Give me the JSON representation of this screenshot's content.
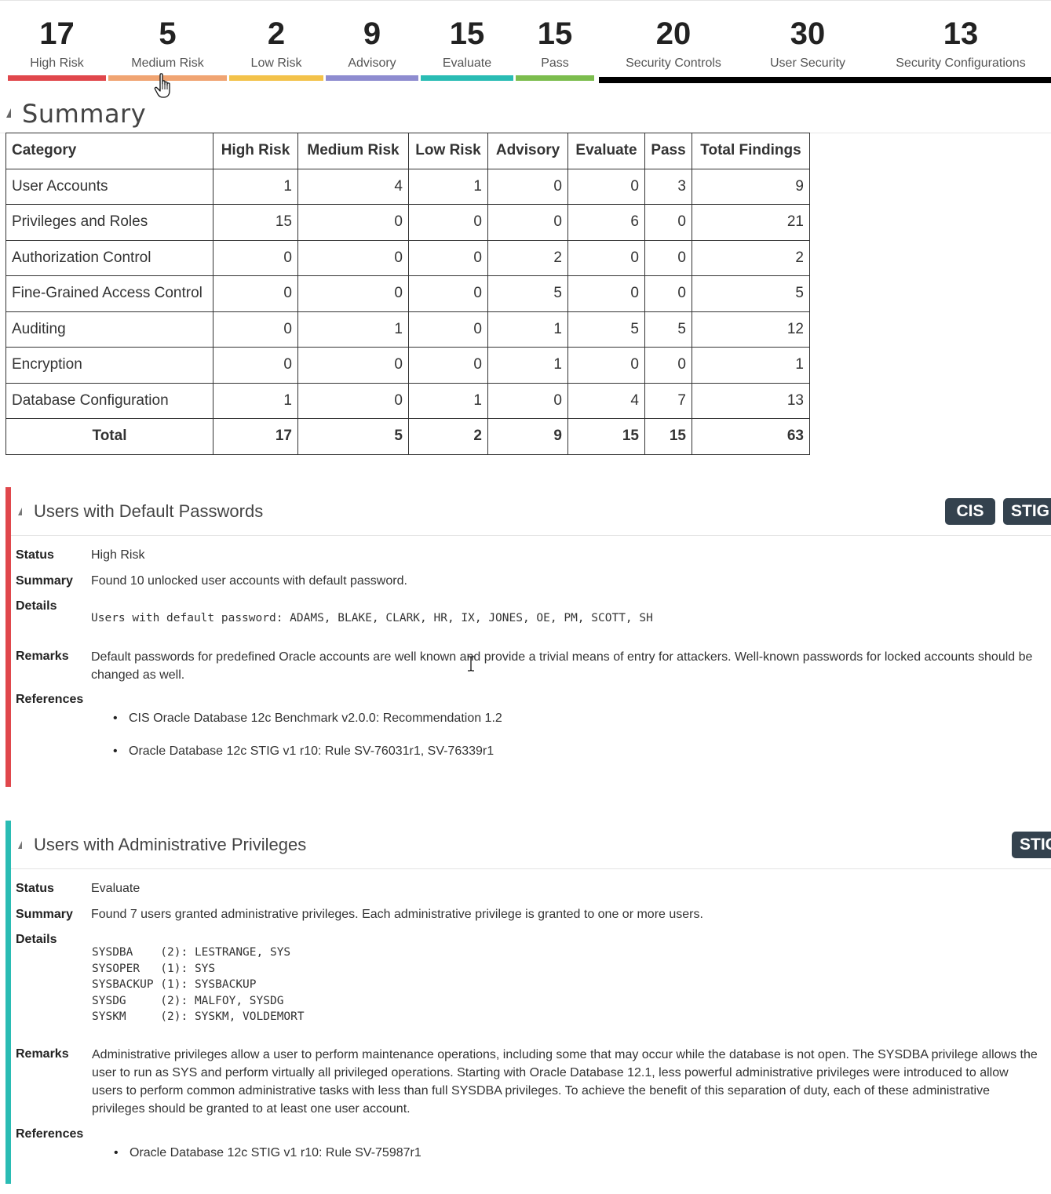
{
  "stats": [
    {
      "count": "17",
      "label": "High Risk",
      "color": "#e0474c"
    },
    {
      "count": "5",
      "label": "Medium Risk",
      "color": "#f0a472"
    },
    {
      "count": "2",
      "label": "Low Risk",
      "color": "#f3c24a"
    },
    {
      "count": "9",
      "label": "Advisory",
      "color": "#8e8cd0"
    },
    {
      "count": "15",
      "label": "Evaluate",
      "color": "#2abcb4"
    },
    {
      "count": "15",
      "label": "Pass",
      "color": "#7cbd4e"
    },
    {
      "count": "20",
      "label": "Security Controls",
      "color": "#000000"
    },
    {
      "count": "30",
      "label": "User Security",
      "color": "#000000"
    },
    {
      "count": "13",
      "label": "Security Configurations",
      "color": "#000000"
    }
  ],
  "summary": {
    "title": "Summary",
    "headers": [
      "Category",
      "High Risk",
      "Medium Risk",
      "Low Risk",
      "Advisory",
      "Evaluate",
      "Pass",
      "Total Findings"
    ],
    "rows": [
      [
        "User Accounts",
        "1",
        "4",
        "1",
        "0",
        "0",
        "3",
        "9"
      ],
      [
        "Privileges and Roles",
        "15",
        "0",
        "0",
        "0",
        "6",
        "0",
        "21"
      ],
      [
        "Authorization Control",
        "0",
        "0",
        "0",
        "2",
        "0",
        "0",
        "2"
      ],
      [
        "Fine-Grained Access Control",
        "0",
        "0",
        "0",
        "5",
        "0",
        "0",
        "5"
      ],
      [
        "Auditing",
        "0",
        "1",
        "0",
        "1",
        "5",
        "5",
        "12"
      ],
      [
        "Encryption",
        "0",
        "0",
        "0",
        "1",
        "0",
        "0",
        "1"
      ],
      [
        "Database Configuration",
        "1",
        "0",
        "1",
        "0",
        "4",
        "7",
        "13"
      ]
    ],
    "total": [
      "Total",
      "17",
      "5",
      "2",
      "9",
      "15",
      "15",
      "63"
    ]
  },
  "finding1": {
    "title": "Users with Default Passwords",
    "tags": [
      "CIS",
      "STIG"
    ],
    "accent": "#e0474c",
    "status_label": "Status",
    "status": "High Risk",
    "summary_label": "Summary",
    "summary": "Found 10 unlocked user accounts with default password.",
    "details_label": "Details",
    "details": "Users with default password: ADAMS, BLAKE, CLARK, HR, IX, JONES, OE, PM, SCOTT, SH",
    "remarks_label": "Remarks",
    "remarks": "Default passwords for predefined Oracle accounts are well known and provide a trivial means of entry for attackers. Well-known passwords for locked accounts should be changed as well.",
    "references_label": "References",
    "references": [
      "CIS Oracle Database 12c Benchmark v2.0.0: Recommendation 1.2",
      "Oracle Database 12c STIG v1 r10: Rule SV-76031r1, SV-76339r1"
    ]
  },
  "finding2": {
    "title": "Users with Administrative Privileges",
    "tags": [
      "STIG"
    ],
    "accent": "#2abcb4",
    "status_label": "Status",
    "status": "Evaluate",
    "summary_label": "Summary",
    "summary": "Found 7 users granted administrative privileges. Each administrative privilege is granted to one or more users.",
    "details_label": "Details",
    "details": "SYSDBA    (2): LESTRANGE, SYS\nSYSOPER   (1): SYS\nSYSBACKUP (1): SYSBACKUP\nSYSDG     (2): MALFOY, SYSDG\nSYSKM     (2): SYSKM, VOLDEMORT",
    "remarks_label": "Remarks",
    "remarks": "Administrative privileges allow a user to perform maintenance operations, including some that may occur while the database is not open. The SYSDBA privilege allows the user to run as SYS and perform virtually all privileged operations. Starting with Oracle Database 12.1, less powerful administrative privileges were introduced to allow users to perform common administrative tasks with less than full SYSDBA privileges. To achieve the benefit of this separation of duty, each of these administrative privileges should be granted to at least one user account.",
    "references_label": "References",
    "references": [
      "Oracle Database 12c STIG v1 r10: Rule SV-75987r1"
    ]
  }
}
